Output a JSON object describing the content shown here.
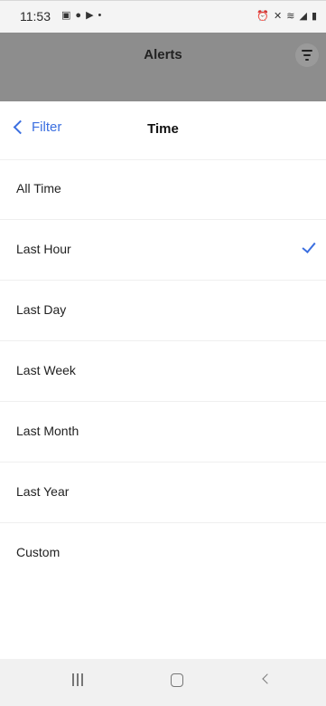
{
  "status_bar": {
    "time": "11:53",
    "left_icons": [
      "gallery-icon",
      "facebook-icon",
      "youtube-icon",
      "dot-icon"
    ],
    "right_icons": [
      "alarm-icon",
      "mute-icon",
      "wifi-icon",
      "signal-icon",
      "battery-icon"
    ]
  },
  "background_screen": {
    "title": "Alerts"
  },
  "sheet": {
    "back_label": "Filter",
    "title": "Time",
    "options": [
      {
        "label": "All Time",
        "selected": false
      },
      {
        "label": "Last Hour",
        "selected": true
      },
      {
        "label": "Last Day",
        "selected": false
      },
      {
        "label": "Last Week",
        "selected": false
      },
      {
        "label": "Last Month",
        "selected": false
      },
      {
        "label": "Last Year",
        "selected": false
      },
      {
        "label": "Custom",
        "selected": false
      }
    ]
  },
  "colors": {
    "accent": "#3b6fe0",
    "dim_overlay": "#8d8d8d"
  }
}
